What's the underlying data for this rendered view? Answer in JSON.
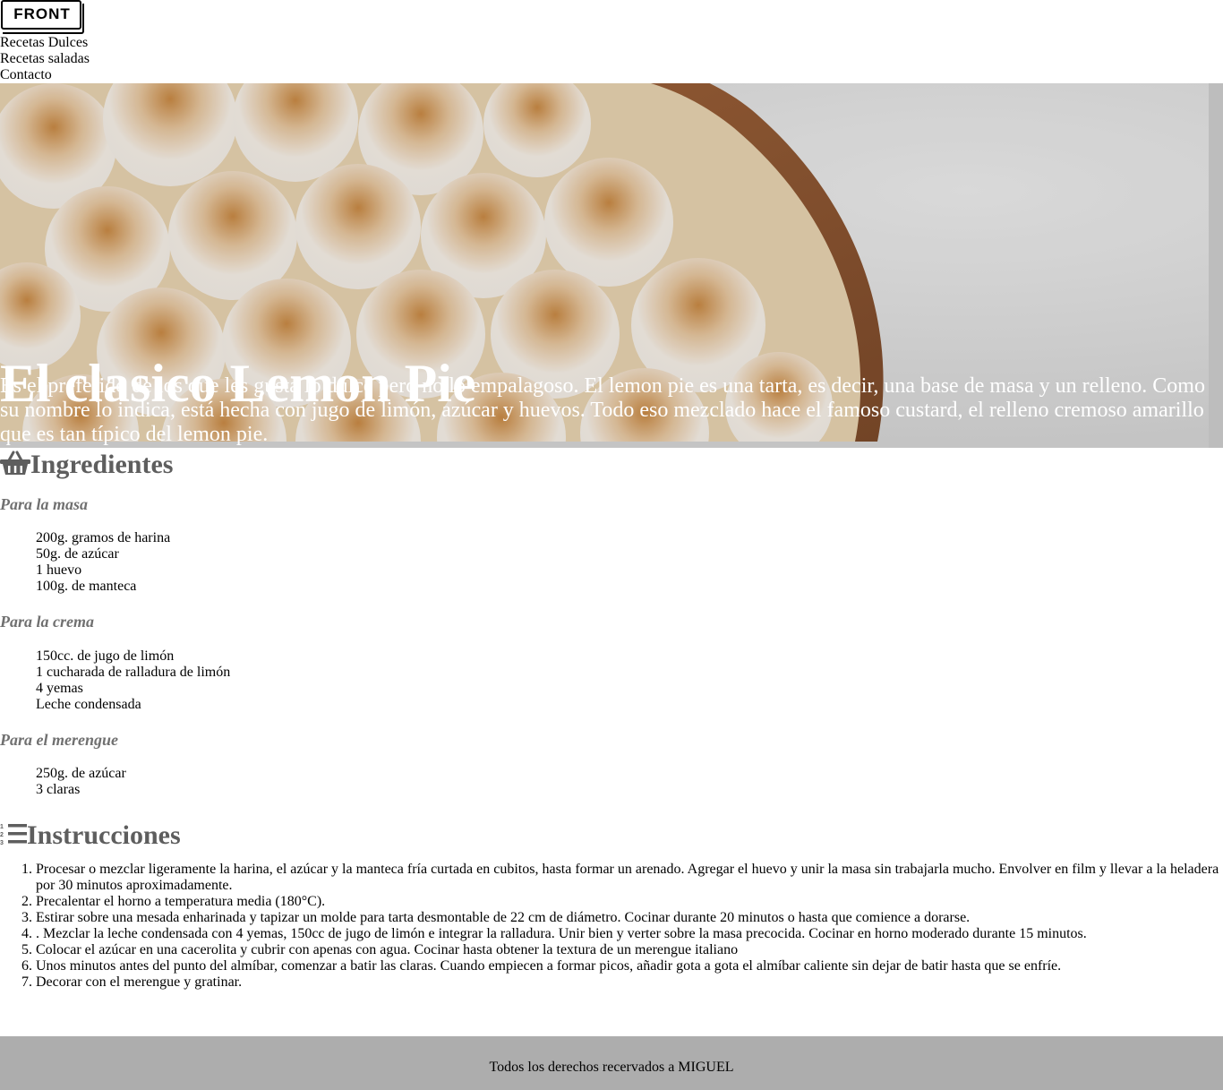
{
  "header": {
    "logo_text": "FRONT",
    "nav": [
      "Recetas Dulces",
      "Recetas saladas",
      "Contacto"
    ]
  },
  "hero": {
    "title": "El clasico Lemon Pie",
    "description": "Es el preferido de los que les gusta lo dulce pero no lo empalagoso. El lemon pie es una tarta, es decir, una base de masa y un relleno. Como su nombre lo indica, está hecha con jugo de limón, azúcar y huevos. Todo eso mezclado hace el famoso custard, el relleno cremoso amarillo que es tan típico del lemon pie."
  },
  "ingredients": {
    "title": "Ingredientes",
    "icon": "basket-icon",
    "groups": [
      {
        "name": "Para la masa",
        "items": [
          "200g. gramos de harina",
          "50g. de azúcar",
          "1 huevo",
          "100g. de manteca"
        ]
      },
      {
        "name": "Para la crema",
        "items": [
          "150cc. de jugo de limón",
          "1 cucharada de ralladura de limón",
          "4 yemas",
          "Leche condensada"
        ]
      },
      {
        "name": "Para el merengue",
        "items": [
          "250g. de azúcar",
          "3 claras"
        ]
      }
    ]
  },
  "instructions": {
    "title": "Instrucciones",
    "icon": "numbered-list-icon",
    "steps": [
      "Procesar o mezclar ligeramente la harina, el azúcar y la manteca fría curtada en cubitos, hasta formar un arenado. Agregar el huevo y unir la masa sin trabajarla mucho. Envolver en film y llevar a la heladera por 30 minutos aproximadamente.",
      "Precalentar el horno a temperatura media (180°C).",
      "Estirar sobre una mesada enharinada y tapizar un molde para tarta desmontable de 22 cm de diámetro. Cocinar durante 20 minutos o hasta que comience a dorarse.",
      ". Mezclar la leche condensada con 4 yemas, 150cc de jugo de limón e integrar la ralladura. Unir bien y verter sobre la masa precocida. Cocinar en horno moderado durante 15 minutos.",
      "Colocar el azúcar en una cacerolita y cubrir con apenas con agua. Cocinar hasta obtener la textura de un merengue italiano",
      "Unos minutos antes del punto del almíbar, comenzar a batir las claras. Cuando empiecen a formar picos, añadir gota a gota el almíbar caliente sin dejar de batir hasta que se enfríe.",
      "Decorar con el merengue y gratinar."
    ]
  },
  "footer": {
    "text": "Todos los derechos recervados a MIGUEL"
  }
}
